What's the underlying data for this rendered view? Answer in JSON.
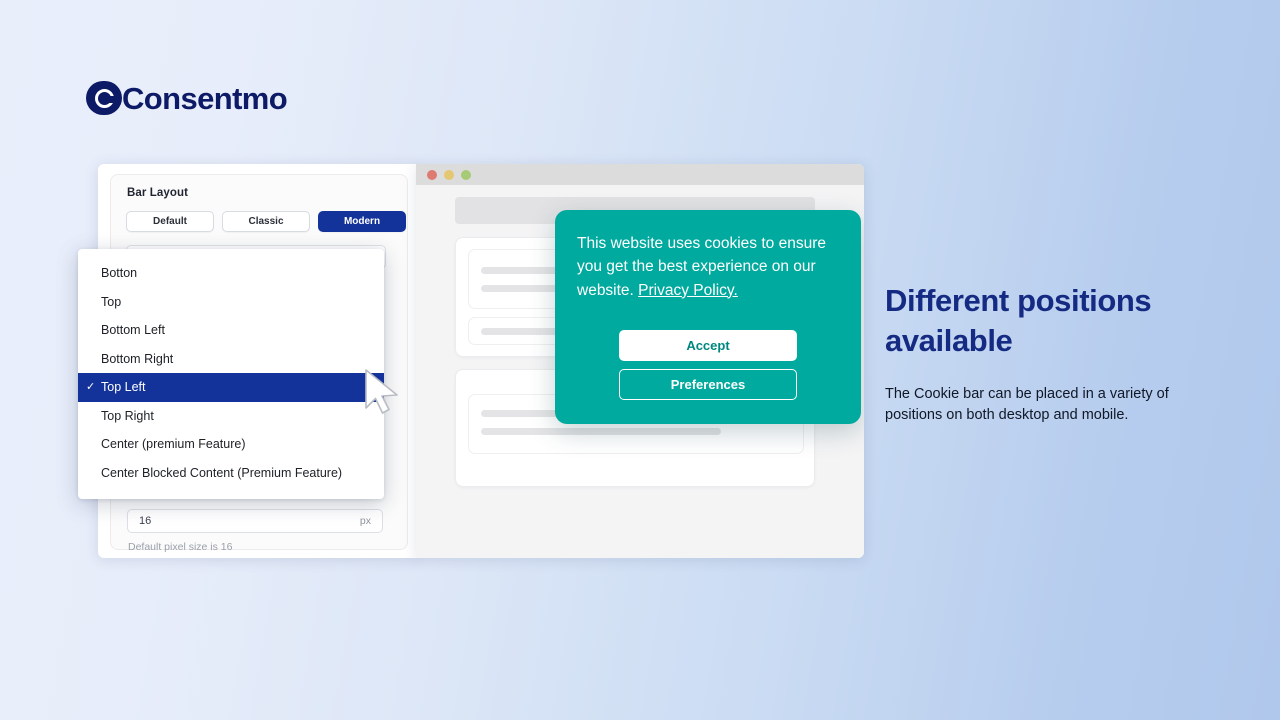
{
  "brand": {
    "name": "Consentmo",
    "logo_mark": "circle-c-icon",
    "navy": "#0d1a66"
  },
  "settings_panel": {
    "title": "Bar Layout",
    "layout_options": [
      {
        "label": "Default",
        "selected": false
      },
      {
        "label": "Classic",
        "selected": false
      },
      {
        "label": "Modern",
        "selected": true
      }
    ],
    "pixel_field": {
      "value": "16",
      "unit": "px",
      "hint": "Default pixel size is 16"
    },
    "selected_accent": "#13339b"
  },
  "dropdown": {
    "items": [
      {
        "label": "Botton",
        "selected": false
      },
      {
        "label": "Top",
        "selected": false
      },
      {
        "label": "Bottom Left",
        "selected": false
      },
      {
        "label": "Bottom Right",
        "selected": false
      },
      {
        "label": "Top Left",
        "selected": true
      },
      {
        "label": "Top Right",
        "selected": false
      },
      {
        "label": "Center (premium Feature)",
        "selected": false
      },
      {
        "label": "Center Blocked Content (Premium Feature)",
        "selected": false
      }
    ],
    "check_glyph": "✓",
    "highlight_color": "#13339b"
  },
  "browser": {
    "traffic_lights": [
      "red",
      "yellow",
      "green"
    ]
  },
  "cookie_banner": {
    "message_before_link": "This website uses cookies to ensure you get the best experience on our website. ",
    "link_label": "Privacy Policy.",
    "accept_label": "Accept",
    "preferences_label": "Preferences",
    "background": "#00aa9e",
    "accept_text_color": "#00887f"
  },
  "copy": {
    "headline": "Different positions available",
    "body": "The Cookie bar can be placed in a variety of positions on both desktop and mobile.",
    "headline_color": "#152a82"
  }
}
